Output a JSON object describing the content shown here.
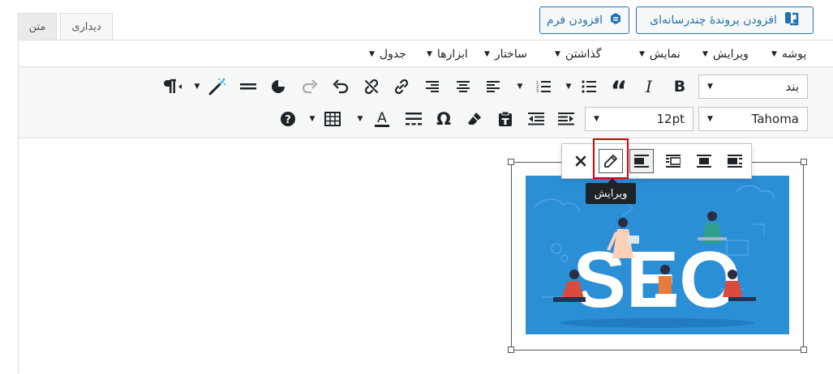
{
  "media_buttons": {
    "add_multilingual": "افزودن پروندهٔ چندرسانه‌ای",
    "add_form": "افزودن فرم"
  },
  "tabs": {
    "visual": "دیداری",
    "text": "متن"
  },
  "menubar": [
    {
      "label": "پوشه"
    },
    {
      "label": "ویرایش"
    },
    {
      "label": "نمایش"
    },
    {
      "label": "گذاشتن"
    },
    {
      "label": "ساختار"
    },
    {
      "label": "ابزارها"
    },
    {
      "label": "جدول"
    }
  ],
  "toolbar": {
    "format_select": "بند",
    "font_family": "Tahoma",
    "font_size": "12pt"
  },
  "image_toolbar": {
    "tooltip": "ویرایش"
  },
  "image": {
    "text": "SEO"
  },
  "colors": {
    "accent": "#2271b1",
    "highlight": "#e00000",
    "image_bg": "#2b8fd6"
  },
  "icons": [
    "close-icon",
    "pencil-icon",
    "align-right-icon",
    "align-center-icon",
    "align-left-icon",
    "align-none-icon"
  ]
}
